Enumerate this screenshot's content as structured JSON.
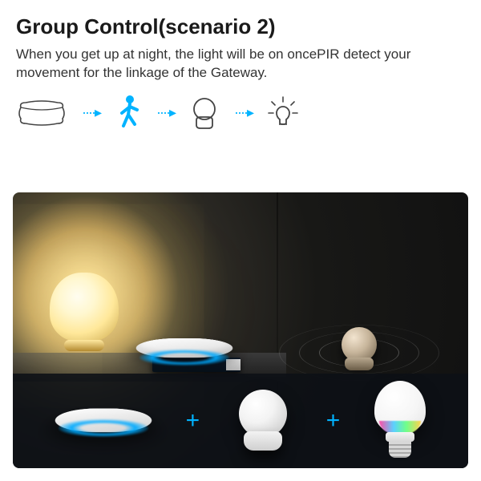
{
  "header": {
    "title": "Group Control(scenario 2)"
  },
  "description": "When you get up at night, the light will be on oncePIR detect your movement for the linkage of the Gateway.",
  "flow": {
    "steps": [
      "pillow",
      "person-walking",
      "pir-sensor",
      "light-bulb"
    ],
    "arrow_glyph": "····▸"
  },
  "strip": {
    "separator_glyph": "+",
    "items": [
      "gateway",
      "pir-sensor",
      "smart-bulb"
    ]
  },
  "colors": {
    "accent": "#00b3ff",
    "lamp_glow": "#ffe89a"
  }
}
